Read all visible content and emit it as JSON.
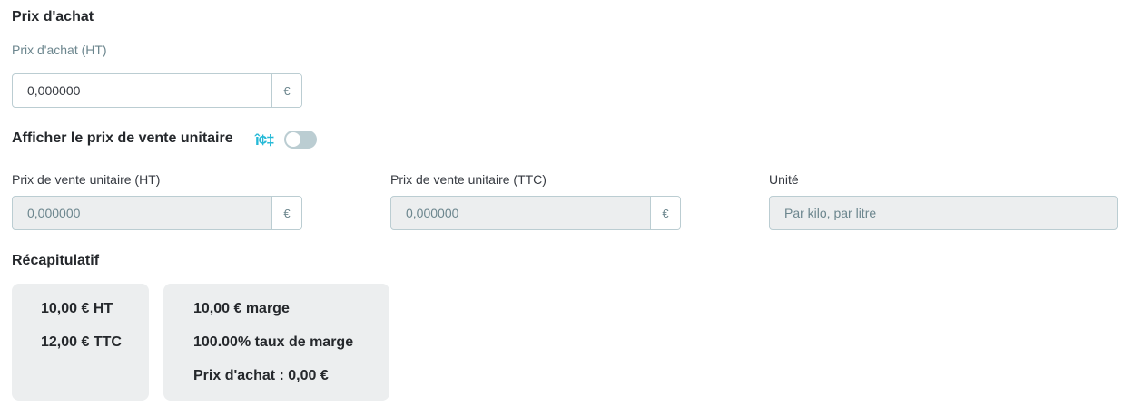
{
  "purchase": {
    "section_title": "Prix d'achat",
    "price_label": "Prix d'achat (HT)",
    "price_value": "0,000000",
    "currency": "€"
  },
  "unit_price": {
    "toggle_label": "Afficher le prix de vente unitaire",
    "help_icon_glyph": "î¢‡",
    "toggle_on": false,
    "ht_label": "Prix de vente unitaire (HT)",
    "ht_value": "0,000000",
    "ttc_label": "Prix de vente unitaire (TTC)",
    "ttc_value": "0,000000",
    "currency": "€",
    "unit_label": "Unité",
    "unit_placeholder": "Par kilo, par litre"
  },
  "summary": {
    "section_title": "Récapitulatif",
    "price_card": {
      "ht": "10,00 € HT",
      "ttc": "12,00 € TTC"
    },
    "margin_card": {
      "margin": "10,00 € marge",
      "margin_rate": "100.00% taux de marge",
      "purchase_price": "Prix d'achat : 0,00 €"
    }
  },
  "colors": {
    "accent": "#25b9d7",
    "border": "#bbcdd2",
    "disabled_bg": "#eceeef",
    "text": "#363a41"
  }
}
